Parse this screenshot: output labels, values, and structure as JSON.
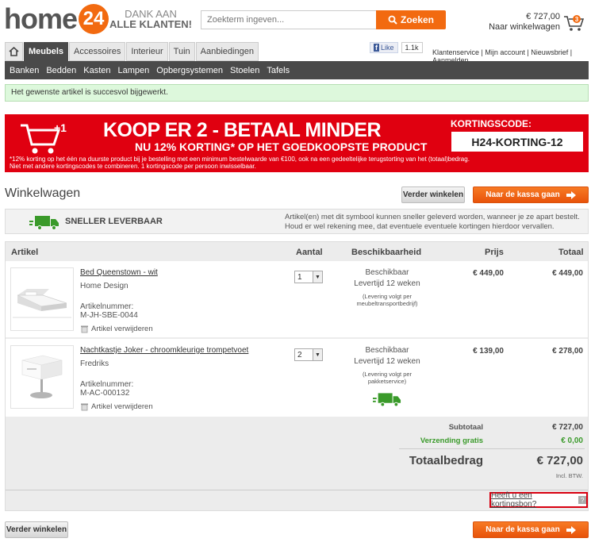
{
  "header": {
    "logo_text": "home",
    "logo_number": "24",
    "thanks_line1": "DANK AAN",
    "thanks_line2": "ALLE KLANTEN!",
    "search_placeholder": "Zoekterm ingeven...",
    "search_button": "Zoeken",
    "cart_amount": "€ 727,00",
    "cart_label": "Naar winkelwagen",
    "cart_count": "3"
  },
  "nav": {
    "tabs": [
      {
        "label": "Meubels",
        "active": true
      },
      {
        "label": "Accessoires"
      },
      {
        "label": "Interieur"
      },
      {
        "label": "Tuin"
      },
      {
        "label": "Aanbiedingen"
      }
    ],
    "fb_like": "Like",
    "fb_count": "1.1k",
    "toplinks": "Klantenservice | Mijn account | Nieuwsbrief | Aanmelden",
    "subnav": [
      "Banken",
      "Bedden",
      "Kasten",
      "Lampen",
      "Opbergsystemen",
      "Stoelen",
      "Tafels"
    ]
  },
  "success_message": "Het gewenste artikel is succesvol bijgewerkt.",
  "banner": {
    "badge": "+1",
    "title": "KOOP ER 2 - BETAAL MINDER",
    "subtitle": "NU 12% KORTING* OP HET GOEDKOOPSTE PRODUCT",
    "small_line1": "*12% korting op het één na duurste product bij je bestelling met een minimum bestelwaarde van €100, ook na een gedeeltelijke terugstorting van het (totaal)bedrag.",
    "small_line2": "Niet met andere kortingscodes te combineren. 1 kortingscode per persoon inwisselbaar.",
    "code_label": "KORTINGSCODE:",
    "code": "H24-KORTING-12"
  },
  "page": {
    "title": "Winkelwagen",
    "continue_shopping": "Verder winkelen",
    "checkout": "Naar de kassa gaan"
  },
  "delivery": {
    "label": "SNELLER LEVERBAAR",
    "text_line1": "Artikel(en) met dit symbool kunnen sneller geleverd worden, wanneer je ze apart bestelt.",
    "text_line2": "Houd er wel rekening mee, dat eventuele eventuele kortingen hierdoor vervallen."
  },
  "table": {
    "headers": {
      "article": "Artikel",
      "qty": "Aantal",
      "availability": "Beschikbaarheid",
      "price": "Prijs",
      "total": "Totaal"
    },
    "items": [
      {
        "name": "Bed Queenstown - wit",
        "brand": "Home Design",
        "sku_label": "Artikelnummer:",
        "sku": "M-JH-SBE-0044",
        "remove": "Artikel verwijderen",
        "qty": "1",
        "status": "Beschikbaar",
        "lead": "Levertijd 12 weken",
        "note": "(Levering volgt per meubeltransportbedrijf)",
        "price": "€ 449,00",
        "total": "€ 449,00"
      },
      {
        "name": "Nachtkastje Joker - chroomkleurige trompetvoet",
        "brand": "Fredriks",
        "sku_label": "Artikelnummer:",
        "sku": "M-AC-000132",
        "remove": "Artikel verwijderen",
        "qty": "2",
        "status": "Beschikbaar",
        "lead": "Levertijd 12 weken",
        "note": "(Levering volgt per pakketservice)",
        "price": "€ 139,00",
        "total": "€ 278,00"
      }
    ],
    "subtotal_label": "Subtotaal",
    "subtotal": "€ 727,00",
    "shipping_label": "Verzending gratis",
    "shipping": "€ 0,00",
    "total_label": "Totaalbedrag",
    "total": "€ 727,00",
    "vat_note": "Incl. BTW.",
    "coupon_link": "Heeft u een kortingsbon?",
    "coupon_help": "?"
  },
  "colors": {
    "accent": "#f26a10",
    "banner": "#e00010",
    "nav_dark": "#4a4a4a",
    "success_bg": "#ddf8dc",
    "green": "#3a9a2a"
  }
}
